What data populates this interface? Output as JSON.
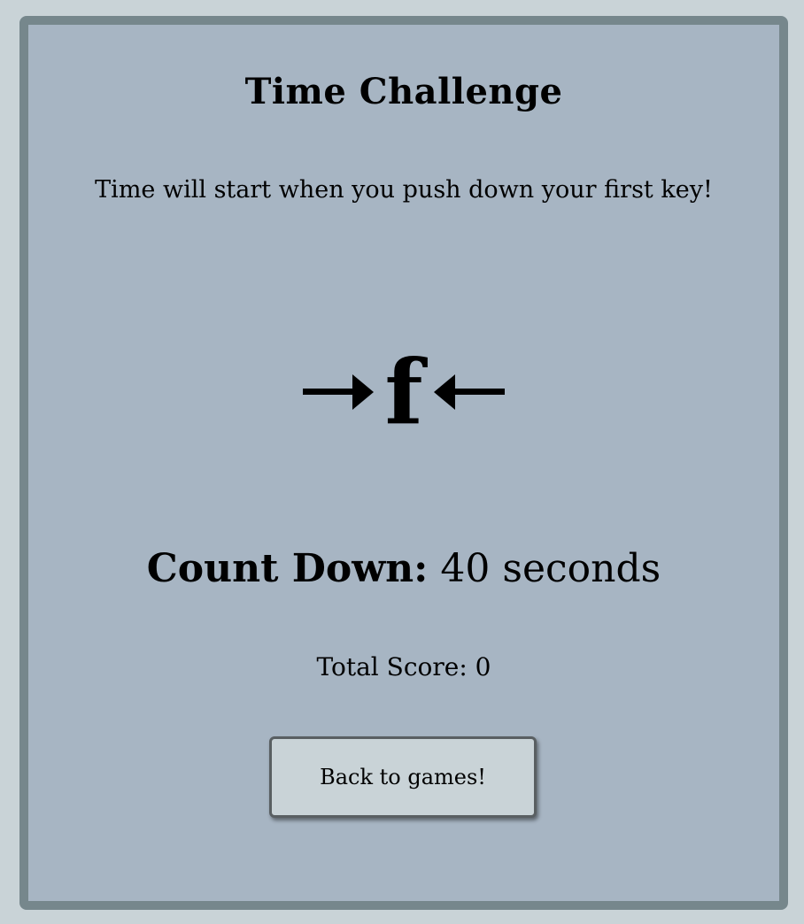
{
  "game": {
    "title": "Time Challenge",
    "instructions": "Time will start when you push down your first key!",
    "target_key": "f",
    "left_arrow_icon": "arrow-right-icon",
    "right_arrow_icon": "arrow-left-icon",
    "countdown_label": "Count Down:",
    "countdown_value": "40 seconds",
    "score_label": "Total Score:",
    "score_value": "0",
    "back_button_label": "Back to games!"
  },
  "colors": {
    "page_background": "#c9d3d7",
    "panel_background": "#a7b5c3",
    "panel_border": "#76878c",
    "button_background": "#c9d3d7"
  }
}
